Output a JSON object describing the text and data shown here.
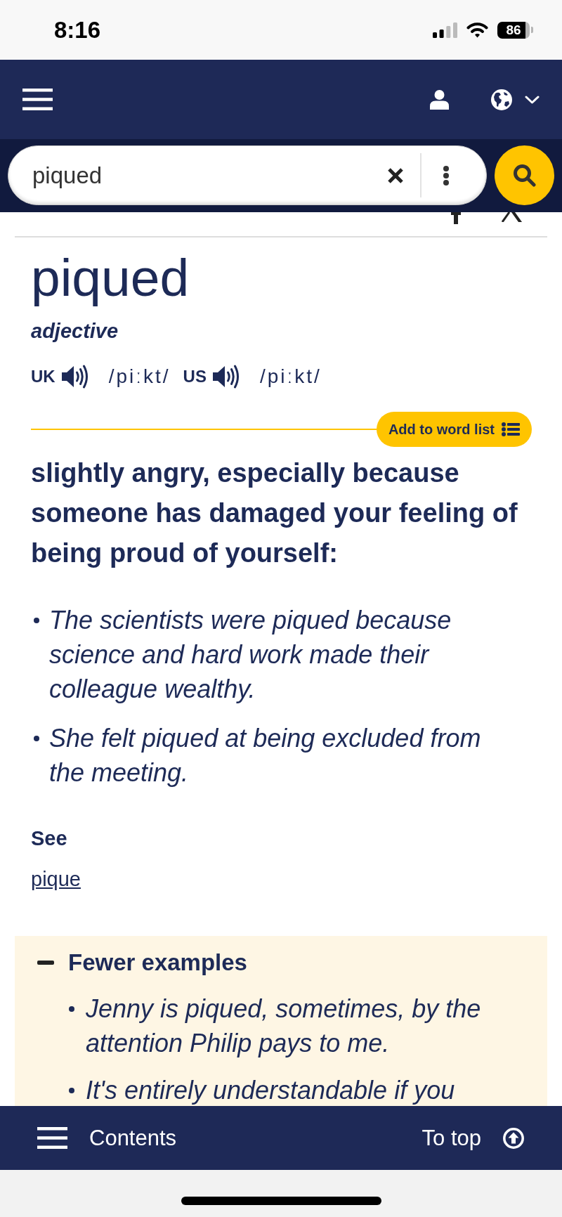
{
  "status_bar": {
    "time": "8:16",
    "battery": "86"
  },
  "search": {
    "value": "piqued"
  },
  "entry": {
    "headword": "piqued",
    "part_of_speech": "adjective",
    "pronunciations": [
      {
        "region": "UK",
        "ipa": "/piːkt/"
      },
      {
        "region": "US",
        "ipa": "/piːkt/"
      }
    ],
    "add_to_word_list": "Add to word list",
    "definition": "slightly angry, especially because someone has damaged your feeling of being proud of yourself:",
    "examples": [
      "The scientists were piqued because science and hard work made their colleague wealthy.",
      "She felt piqued at being excluded from the meeting."
    ],
    "see_label": "See",
    "see_link": "pique"
  },
  "more_examples": {
    "toggle": "Fewer examples",
    "expanded": true,
    "examples": [
      "Jenny is piqued, sometimes, by the attention Philip pays to me.",
      "It's entirely understandable if you"
    ]
  },
  "bottom_bar": {
    "contents": "Contents",
    "to_top": "To top"
  }
}
